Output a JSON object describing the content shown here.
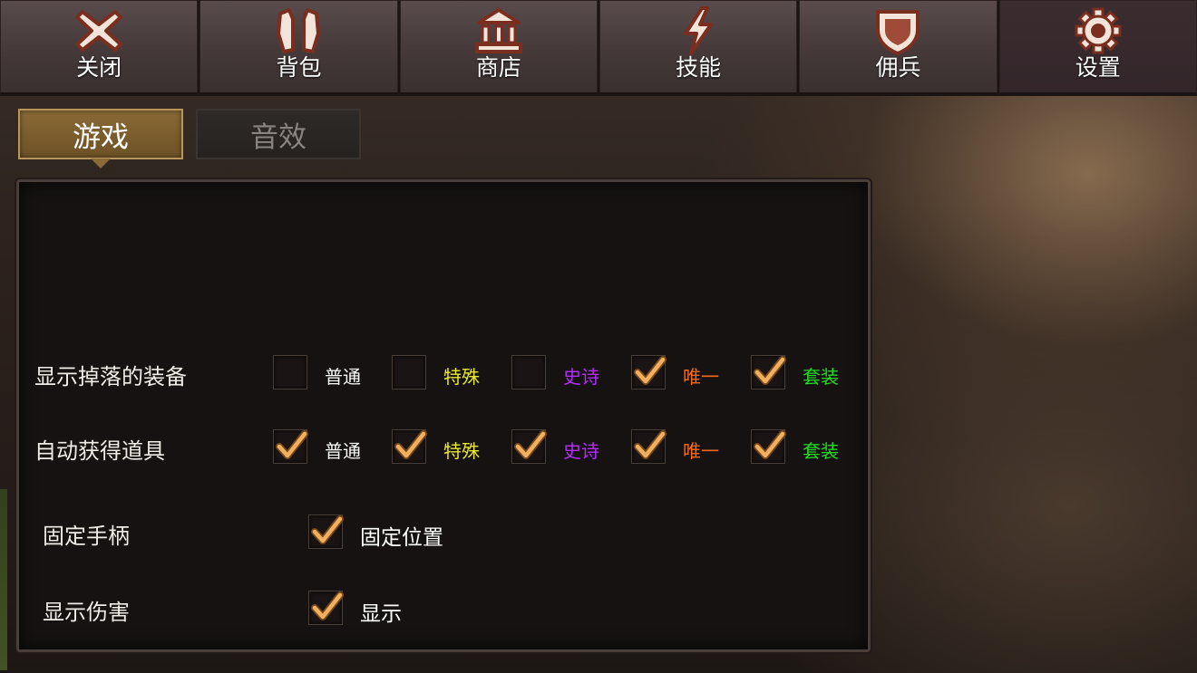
{
  "top_tabs": [
    {
      "label": "关闭",
      "icon": "close-icon"
    },
    {
      "label": "背包",
      "icon": "backpack-icon"
    },
    {
      "label": "商店",
      "icon": "shop-icon"
    },
    {
      "label": "技能",
      "icon": "lightning-icon"
    },
    {
      "label": "佣兵",
      "icon": "shield-icon"
    },
    {
      "label": "设置",
      "icon": "gear-icon",
      "active": true
    }
  ],
  "sub_tabs": {
    "game": "游戏",
    "sound": "音效",
    "active": "game"
  },
  "settings": {
    "drop_display": {
      "label": "显示掉落的装备",
      "options": [
        {
          "label": "普通",
          "checked": false,
          "color": "#ffffff"
        },
        {
          "label": "特殊",
          "checked": false,
          "color": "#e8e830"
        },
        {
          "label": "史诗",
          "checked": false,
          "color": "#b42cff"
        },
        {
          "label": "唯一",
          "checked": true,
          "color": "#ff6a1a"
        },
        {
          "label": "套装",
          "checked": true,
          "color": "#22dd22"
        }
      ]
    },
    "auto_pickup": {
      "label": "自动获得道具",
      "options": [
        {
          "label": "普通",
          "checked": true,
          "color": "#ffffff"
        },
        {
          "label": "特殊",
          "checked": true,
          "color": "#e8e830"
        },
        {
          "label": "史诗",
          "checked": true,
          "color": "#b42cff"
        },
        {
          "label": "唯一",
          "checked": true,
          "color": "#ff6a1a"
        },
        {
          "label": "套装",
          "checked": true,
          "color": "#22dd22"
        }
      ]
    },
    "fixed_joystick": {
      "label": "固定手柄",
      "option": "固定位置",
      "checked": true
    },
    "show_damage": {
      "label": "显示伤害",
      "option": "显示",
      "checked": true
    }
  }
}
